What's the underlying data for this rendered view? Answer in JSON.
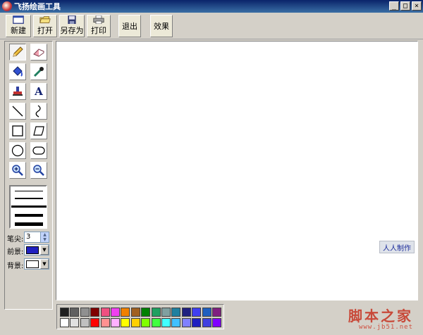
{
  "window": {
    "title": "飞扬绘画工具",
    "controls": {
      "minimize": "_",
      "maximize": "□",
      "close": "×"
    }
  },
  "toolbar": {
    "new_label": "新建",
    "open_label": "打开",
    "saveas_label": "另存为",
    "print_label": "打印",
    "exit_label": "退出",
    "effect_label": "效果"
  },
  "tools": [
    {
      "name": "pencil-icon",
      "glyph": "✏"
    },
    {
      "name": "eraser-icon",
      "glyph": "▱"
    },
    {
      "name": "paint-bucket-icon",
      "glyph": "◈"
    },
    {
      "name": "eyedropper-icon",
      "glyph": "⁄"
    },
    {
      "name": "stamp-icon",
      "glyph": "▃"
    },
    {
      "name": "text-icon",
      "glyph": "A"
    },
    {
      "name": "line-icon",
      "glyph": "╲"
    },
    {
      "name": "curve-icon",
      "glyph": "∫"
    },
    {
      "name": "rectangle-icon",
      "glyph": "□"
    },
    {
      "name": "polygon-icon",
      "glyph": "▱"
    },
    {
      "name": "ellipse-icon",
      "glyph": "○"
    },
    {
      "name": "rounded-rect-icon",
      "glyph": "▭"
    },
    {
      "name": "zoom-in-icon",
      "glyph": "⊕"
    },
    {
      "name": "zoom-out-icon",
      "glyph": "⊖"
    }
  ],
  "settings": {
    "pen_tip_label": "笔尖:",
    "pen_tip_value": "3",
    "foreground_label": "前景:",
    "foreground_color": "#2020c0",
    "background_label": "背景:",
    "background_color": "#ffffff"
  },
  "canvas": {
    "credit_label": "人人制作"
  },
  "palette": {
    "row1": [
      "#202020",
      "#606060",
      "#909090",
      "#800000",
      "#f05080",
      "#f040f0",
      "#f08000",
      "#a06020",
      "#008000",
      "#20a060",
      "#80a0a0",
      "#2080a0",
      "#202080",
      "#4040f0",
      "#2060c0",
      "#802080"
    ],
    "row2": [
      "#ffffff",
      "#e0e0e0",
      "#c0c0c0",
      "#ff0000",
      "#ff9090",
      "#ffb0ff",
      "#ffff00",
      "#ffd000",
      "#80ff00",
      "#40ff40",
      "#40ffff",
      "#40c0ff",
      "#8080ff",
      "#2020c0",
      "#4040e0",
      "#8000ff"
    ]
  },
  "watermark": {
    "main": "脚本之家",
    "url": "www.jb51.net"
  }
}
